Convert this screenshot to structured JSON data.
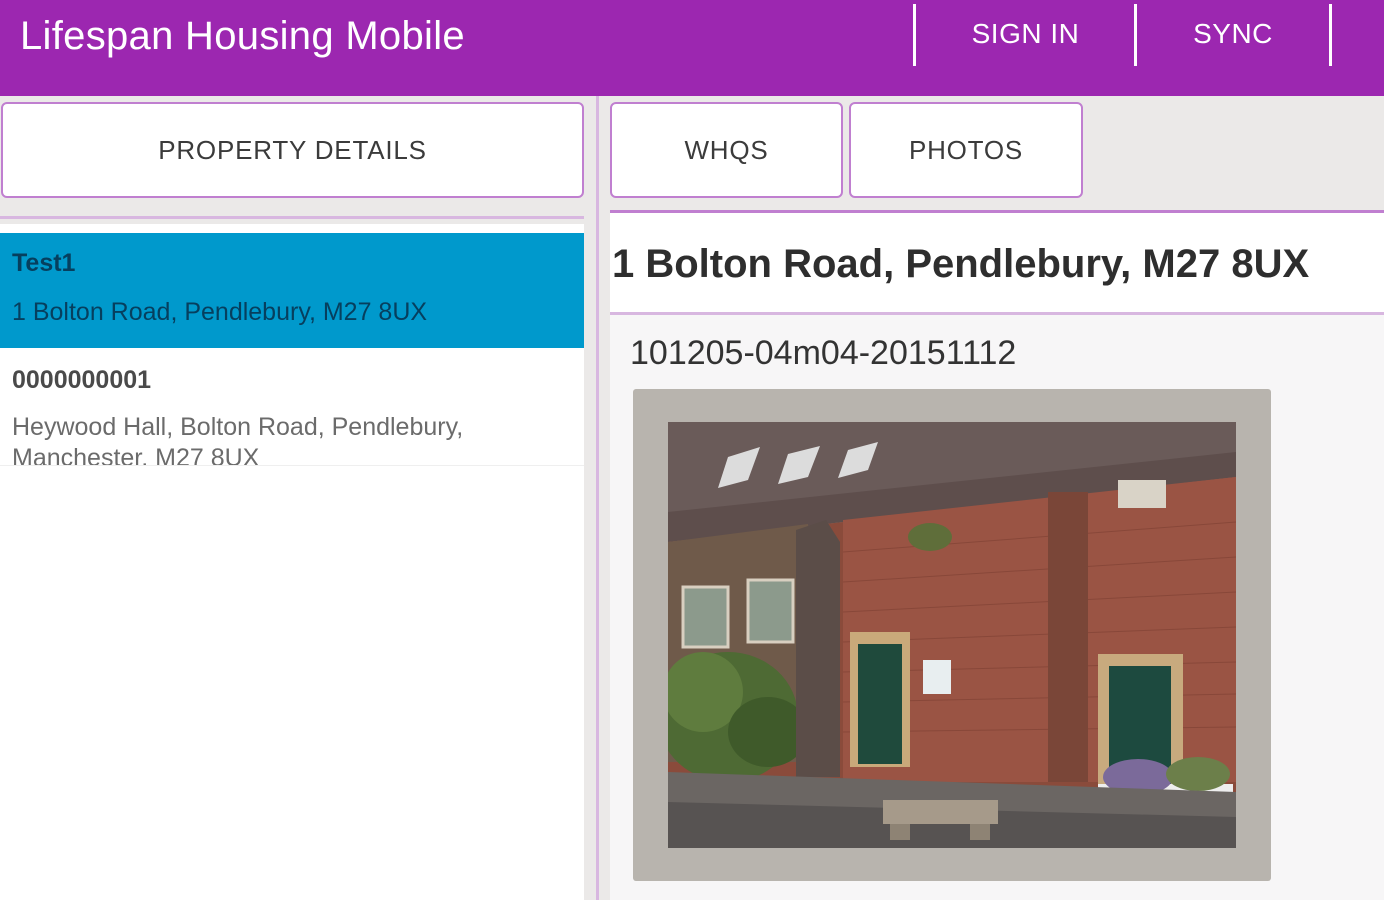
{
  "app": {
    "title": "Lifespan Housing Mobile",
    "actions": {
      "sign_in": "SIGN IN",
      "sync": "SYNC"
    }
  },
  "left_tabs": {
    "property_details": "PROPERTY DETAILS"
  },
  "right_tabs": {
    "whqs": "WHQS",
    "photos": "PHOTOS"
  },
  "properties": [
    {
      "title": "Test1",
      "address": "1 Bolton Road, Pendlebury, M27 8UX",
      "selected": true
    },
    {
      "title": "0000000001",
      "address": "Heywood Hall, Bolton Road, Pendlebury, Manchester, M27 8UX",
      "selected": false
    }
  ],
  "detail": {
    "heading": "1 Bolton Road, Pendlebury, M27 8UX",
    "photo_caption": "101205-04m04-20151112"
  },
  "colors": {
    "appbar": "#9c27b0",
    "selected_row": "#0099cc",
    "tab_border": "#c07fd0",
    "pane_background": "#ebe9e8"
  }
}
